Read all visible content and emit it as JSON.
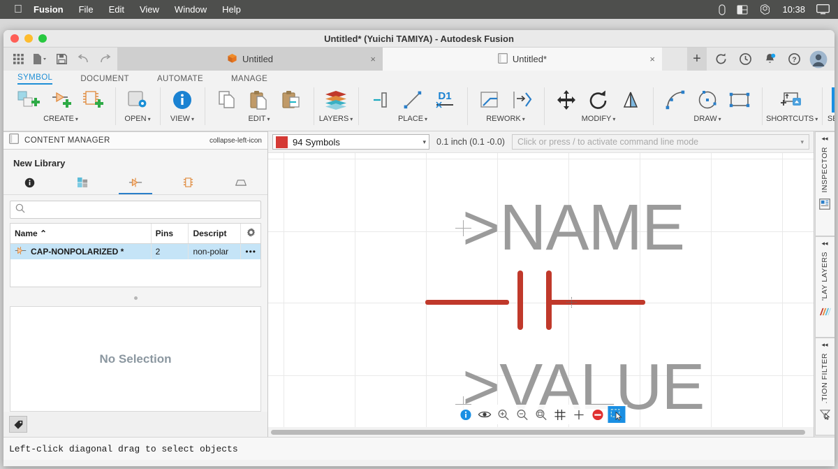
{
  "menubar": {
    "apple": "apple-logo",
    "items": [
      {
        "label": "Fusion",
        "bold": true
      },
      {
        "label": "File",
        "bold": false
      },
      {
        "label": "Edit",
        "bold": false
      },
      {
        "label": "View",
        "bold": false
      },
      {
        "label": "Window",
        "bold": false
      },
      {
        "label": "Help",
        "bold": false
      }
    ],
    "status_icons": [
      "battery-icon",
      "panel-layout-icon",
      "openai-icon"
    ],
    "clock": "10:38",
    "display_icon": "display-icon"
  },
  "window": {
    "title": "Untitled* (Yuichi TAMIYA) - Autodesk Fusion"
  },
  "quickaccess": {
    "icons": [
      "grid-apps-icon",
      "new-document-icon",
      "save-icon",
      "undo-icon",
      "redo-icon"
    ],
    "tabs": [
      {
        "label": "Untitled",
        "icon": "fusion-cube-icon",
        "active": false,
        "close": "×"
      },
      {
        "label": "Untitled*",
        "icon": "schematic-doc-icon",
        "active": true,
        "close": "×"
      }
    ],
    "add_tab": "+",
    "right_icons": [
      "refresh-icon",
      "recent-icon",
      "notifications-icon",
      "help-icon",
      "account-avatar"
    ]
  },
  "ribbon": {
    "tabs": [
      {
        "label": "SYMBOL",
        "active": true
      },
      {
        "label": "DOCUMENT",
        "active": false
      },
      {
        "label": "AUTOMATE",
        "active": false
      },
      {
        "label": "MANAGE",
        "active": false
      }
    ],
    "groups": [
      {
        "label": "CREATE",
        "caret": "▾",
        "icons": [
          "new-device-icon",
          "new-symbol-icon",
          "new-footprint-icon"
        ]
      },
      {
        "label": "OPEN",
        "caret": "▾",
        "icons": [
          "open-library-icon"
        ]
      },
      {
        "label": "VIEW",
        "caret": "▾",
        "icons": [
          "info-view-icon"
        ]
      },
      {
        "label": "EDIT",
        "caret": "▾",
        "icons": [
          "copy-icon",
          "paste-icon",
          "paste-special-icon"
        ]
      },
      {
        "label": "LAYERS",
        "caret": "▾",
        "icons": [
          "layers-stack-icon"
        ]
      },
      {
        "label": "PLACE",
        "caret": "▾",
        "icons": [
          "place-pin-icon",
          "place-line-icon",
          "place-dimension-icon"
        ]
      },
      {
        "label": "REWORK",
        "caret": "▾",
        "icons": [
          "split-icon",
          "mirror-move-icon"
        ]
      },
      {
        "label": "MODIFY",
        "caret": "▾",
        "icons": [
          "move-icon",
          "rotate-icon",
          "mirror-icon"
        ]
      },
      {
        "label": "DRAW",
        "caret": "▾",
        "icons": [
          "arc-icon",
          "circle-icon",
          "rectangle-icon"
        ]
      },
      {
        "label": "SHORTCUTS",
        "caret": "▾",
        "icons": [
          "shortcuts-icon"
        ]
      },
      {
        "label": "SELECT",
        "caret": "▾",
        "icons": [
          "select-area-icon"
        ]
      }
    ]
  },
  "content_manager": {
    "header": "CONTENT MANAGER",
    "header_icon": "library-icon",
    "collapse_icon": "collapse-left-icon",
    "library_title": "New Library",
    "tabs": [
      {
        "name": "info-tab",
        "icon": "info-icon",
        "active": false
      },
      {
        "name": "devices-tab",
        "icon": "device-blocks-icon",
        "active": false
      },
      {
        "name": "symbols-tab",
        "icon": "symbol-icon",
        "active": true
      },
      {
        "name": "footprints-tab",
        "icon": "footprint-icon",
        "active": false
      },
      {
        "name": "packages-3d-tab",
        "icon": "package-3d-icon",
        "active": false
      }
    ],
    "search": {
      "value": "",
      "placeholder": "",
      "icon": "search-icon"
    },
    "table": {
      "columns": [
        "Name ⌃",
        "Pins",
        "Descript"
      ],
      "settings_icon": "gear-icon",
      "rows": [
        {
          "icon": "symbol-icon",
          "name": "CAP-NONPOLARIZED *",
          "pins": "2",
          "description": "non-polar",
          "overflow": "•••",
          "selected": true
        }
      ]
    },
    "properties": {
      "empty_text": "No Selection"
    },
    "footer_icon": "tag-icon"
  },
  "canvas_toolbar": {
    "layer": {
      "label": "94 Symbols",
      "color": "#d53a35",
      "caret": "▾"
    },
    "grid_info": "0.1 inch (0.1 -0.0)",
    "command_line": {
      "value": "",
      "placeholder": "Click or press / to activate command line mode",
      "caret": "▾"
    }
  },
  "canvas": {
    "name_text": ">NAME",
    "value_text": ">VALUE",
    "symbol_color": "#c0392b",
    "text_color": "#9b9b9b",
    "bottom_tools": [
      {
        "name": "info-tool",
        "icon": "info-icon",
        "active": false,
        "accent": "#1a8fe3"
      },
      {
        "name": "visibility-tool",
        "icon": "eye-icon",
        "active": false
      },
      {
        "name": "zoom-in-tool",
        "icon": "zoom-in-icon",
        "active": false
      },
      {
        "name": "zoom-out-tool",
        "icon": "zoom-out-icon",
        "active": false
      },
      {
        "name": "zoom-fit-tool",
        "icon": "zoom-fit-icon",
        "active": false
      },
      {
        "name": "grid-tool",
        "icon": "grid-icon",
        "active": false
      },
      {
        "name": "crosshair-tool",
        "icon": "crosshair-icon",
        "active": false
      },
      {
        "name": "stop-tool",
        "icon": "stop-icon",
        "active": false,
        "accent": "#e03030"
      },
      {
        "name": "select-tool",
        "icon": "select-area-icon",
        "active": true
      }
    ]
  },
  "right_rail": {
    "panels": [
      {
        "label": "INSPECTOR",
        "icon": "inspector-icon",
        "collapse": "◂◂"
      },
      {
        "label": "'LAY LAYERS",
        "icon": "display-layers-icon",
        "collapse": "◂◂"
      },
      {
        "label": ".TION FILTER",
        "icon": "selection-filter-icon",
        "collapse": "◂◂"
      }
    ]
  },
  "statusbar": {
    "message": "Left-click diagonal drag to select objects"
  }
}
